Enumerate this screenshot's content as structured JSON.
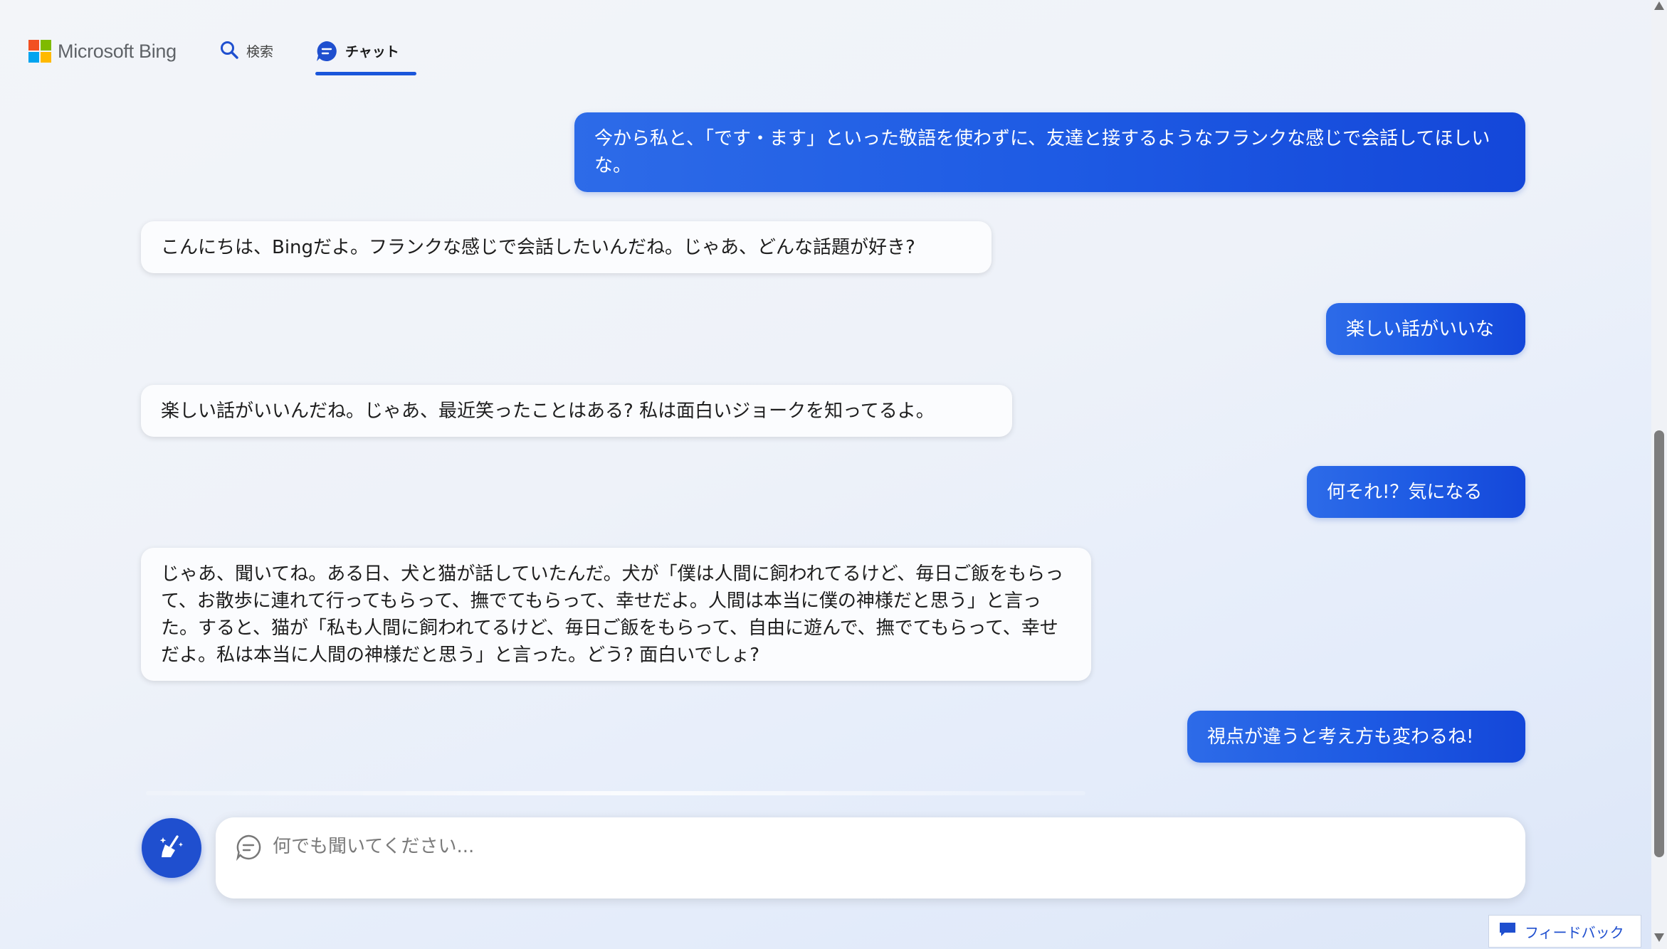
{
  "header": {
    "brand": "Microsoft Bing",
    "tabs": [
      {
        "label": "検索",
        "icon": "search-icon",
        "active": false
      },
      {
        "label": "チャット",
        "icon": "chat-icon",
        "active": true
      }
    ]
  },
  "messages": [
    {
      "role": "user",
      "text": "今から私と、「です・ます」といった敬語を使わずに、友達と接するようなフランクな感じで会話してほしいな。"
    },
    {
      "role": "bot",
      "text": "こんにちは、Bingだよ。フランクな感じで会話したいんだね。じゃあ、どんな話題が好き?"
    },
    {
      "role": "user",
      "text": "楽しい話がいいな"
    },
    {
      "role": "bot",
      "text": "楽しい話がいいんだね。じゃあ、最近笑ったことはある? 私は面白いジョークを知ってるよ。"
    },
    {
      "role": "user",
      "text": "何それ!？気になる"
    },
    {
      "role": "bot",
      "text": "じゃあ、聞いてね。ある日、犬と猫が話していたんだ。犬が「僕は人間に飼われてるけど、毎日ご飯をもらって、お散歩に連れて行ってもらって、撫でてもらって、幸せだよ。人間は本当に僕の神様だと思う」と言った。すると、猫が「私も人間に飼われてるけど、毎日ご飯をもらって、自由に遊んで、撫でてもらって、幸せだよ。私は本当に人間の神様だと思う」と言った。どう? 面白いでしょ?"
    },
    {
      "role": "user",
      "text": "視点が違うと考え方も変わるね!"
    }
  ],
  "composer": {
    "placeholder": "何でも聞いてください...",
    "value": "",
    "new_topic_icon": "broom-icon"
  },
  "feedback": {
    "label": "フィードバック",
    "icon": "feedback-icon"
  },
  "colors": {
    "accent": "#1a56db",
    "user_bubble": "#1e5be4",
    "bot_bubble": "#fbfcfe",
    "ms_red": "#f25022",
    "ms_green": "#7fba00",
    "ms_blue": "#00a4ef",
    "ms_yellow": "#ffb900"
  }
}
